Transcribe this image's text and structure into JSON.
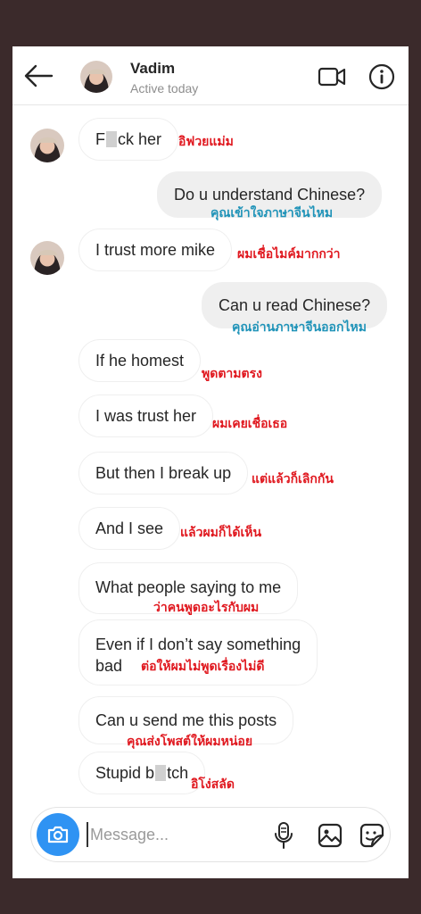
{
  "header": {
    "name": "Vadim",
    "status": "Active today"
  },
  "messages": [
    {
      "side": "in",
      "text_pre": "F",
      "text_post": "ck her",
      "translation": "อิฟวยแม่ม"
    },
    {
      "side": "out",
      "text": "Do u understand Chinese?",
      "translation": "คุณเข้าใจภาษาจีนไหม"
    },
    {
      "side": "in",
      "text": "I trust more mike",
      "translation": "ผมเชื่อไมค์มากกว่า"
    },
    {
      "side": "out",
      "text": "Can u read Chinese?",
      "translation": "คุณอ่านภาษาจีนออกไหม"
    },
    {
      "side": "in",
      "text": "If he homest",
      "translation": "พูดตามตรง"
    },
    {
      "side": "in",
      "text": "I was trust her",
      "translation": "ผมเคยเชื่อเธอ"
    },
    {
      "side": "in",
      "text": "But then I break up",
      "translation": "แต่แล้วก็เลิกกัน"
    },
    {
      "side": "in",
      "text": "And I see",
      "translation": "แล้วผมก็ได้เห็น"
    },
    {
      "side": "in",
      "text": "What people saying to me",
      "translation": "ว่าคนพูดอะไรกับผม"
    },
    {
      "side": "in",
      "text_line1": "Even if I don’t say something",
      "text_line2": "bad",
      "translation": "ต่อให้ผมไม่พูดเรื่องไม่ดี"
    },
    {
      "side": "in",
      "text": "Can u send me this posts",
      "translation": "คุณส่งโพสต์ให้ผมหน่อย"
    },
    {
      "side": "in",
      "text_pre": "Stupid b",
      "text_post": "tch",
      "translation": "อิโง่สลัด"
    }
  ],
  "composer": {
    "placeholder": "Message..."
  },
  "icons": {
    "back": "arrow-left-icon",
    "video": "video-camera-icon",
    "info": "info-circle-icon",
    "camera": "camera-icon",
    "mic": "microphone-icon",
    "gallery": "image-gallery-icon",
    "sticker": "sticker-icon"
  },
  "colors": {
    "translation_red": "#e0181f",
    "translation_blue": "#1f93b8",
    "camera_button": "#2f93f3",
    "outgoing_bubble": "#efefef"
  }
}
